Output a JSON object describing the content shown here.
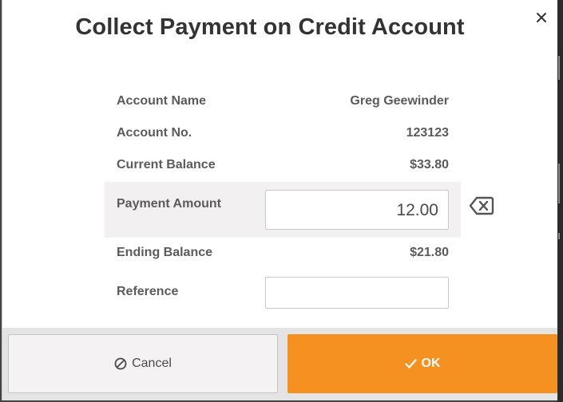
{
  "dialog": {
    "title": "Collect Payment on Credit Account",
    "close_icon": "close-icon"
  },
  "details": {
    "account_name_label": "Account Name",
    "account_name_value": "Greg Geewinder",
    "account_no_label": "Account No.",
    "account_no_value": "123123",
    "current_balance_label": "Current Balance",
    "current_balance_value": "$33.80",
    "payment_amount_label": "Payment Amount",
    "payment_amount_value": "12.00",
    "ending_balance_label": "Ending Balance",
    "ending_balance_value": "$21.80",
    "reference_label": "Reference",
    "reference_value": ""
  },
  "buttons": {
    "cancel_label": "Cancel",
    "cancel_icon": "ban-icon",
    "ok_label": "OK",
    "ok_icon": "check-icon",
    "backspace_icon": "backspace-icon"
  },
  "colors": {
    "accent": "#f59120",
    "highlight_row": "#f2f0f0",
    "footer": "#e4e4e4"
  }
}
